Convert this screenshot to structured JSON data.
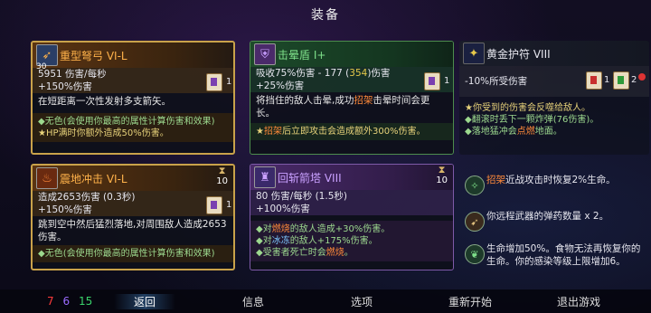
{
  "title": "装备",
  "cards": {
    "crossbow": {
      "name": "重型弩弓 VI-L",
      "level": "30",
      "stat": "5951 伤害/每秒",
      "bonus": "+150%伤害",
      "desc": "在短距离一次性发射多支箭矢。",
      "note1": "无色(会使用你最高的属性计算伤害和效果)",
      "note2": "HP满时你额外造成50%伤害。",
      "scroll_count": "1"
    },
    "shield": {
      "name": "击晕盾 I+",
      "stat_a": "吸收75%伤害 - 177 (",
      "stat_b": "354",
      "stat_c": ")伤害",
      "bonus": "+25%伤害",
      "desc_a": "将挡住的敌人击晕,成功",
      "desc_b": "招架",
      "desc_c": "击晕时间会更长。",
      "note_a": "招架",
      "note_b": "后立即攻击会造成额外300%伤害。",
      "scroll_count": "1"
    },
    "amulet": {
      "name": "黄金护符 VIII",
      "stat": "-10%所受伤害",
      "red_count": "1",
      "green_count": "2",
      "note1": "你受到的伤害会反噬给敌人。",
      "note2": "翻滚时丢下一颗炸弹(76伤害)。",
      "note3_a": "落地猛冲会",
      "note3_b": "点燃",
      "note3_c": "地面。"
    },
    "quake": {
      "name": "震地冲击 VI-L",
      "cooldown": "10",
      "stat": "造成2653伤害 (0.3秒)",
      "bonus": "+150%伤害",
      "desc": "跳到空中然后猛烈落地,对周围敌人造成2653伤害。",
      "note1": "无色(会使用你最高的属性计算伤害和效果)",
      "scroll_count": "1"
    },
    "turret": {
      "name": "回斩箭塔 VIII",
      "cooldown": "10",
      "stat": "80 伤害/每秒 (1.5秒)",
      "bonus": "+100%伤害",
      "note1_a": "对",
      "note1_b": "燃烧",
      "note1_c": "的敌人造成+30%伤害。",
      "note2_a": "对",
      "note2_b": "冰冻",
      "note2_c": "的敌人+175%伤害。",
      "note3_a": "受害者死亡时会",
      "note3_b": "燃烧",
      "note3_c": "。"
    }
  },
  "mutations": [
    {
      "pre": "",
      "hl": "招架",
      "post": "近战攻击时恢复2%生命。"
    },
    {
      "pre": "你远程武器的弹药数量 x 2。",
      "hl": "",
      "post": ""
    },
    {
      "pre": "生命增加50%。食物无法再恢复你的生命。你的感染等级上限增加6。",
      "hl": "",
      "post": ""
    }
  ],
  "scrolls": {
    "red": "7",
    "purple": "6",
    "green": "15"
  },
  "nav": [
    "返回",
    "信息",
    "选项",
    "重新开始",
    "退出游戏"
  ],
  "colors": {
    "gold": "#c9a24a",
    "brutality": "#ff3b3b",
    "tactics": "#9b6bff",
    "survival": "#3ad36b"
  }
}
